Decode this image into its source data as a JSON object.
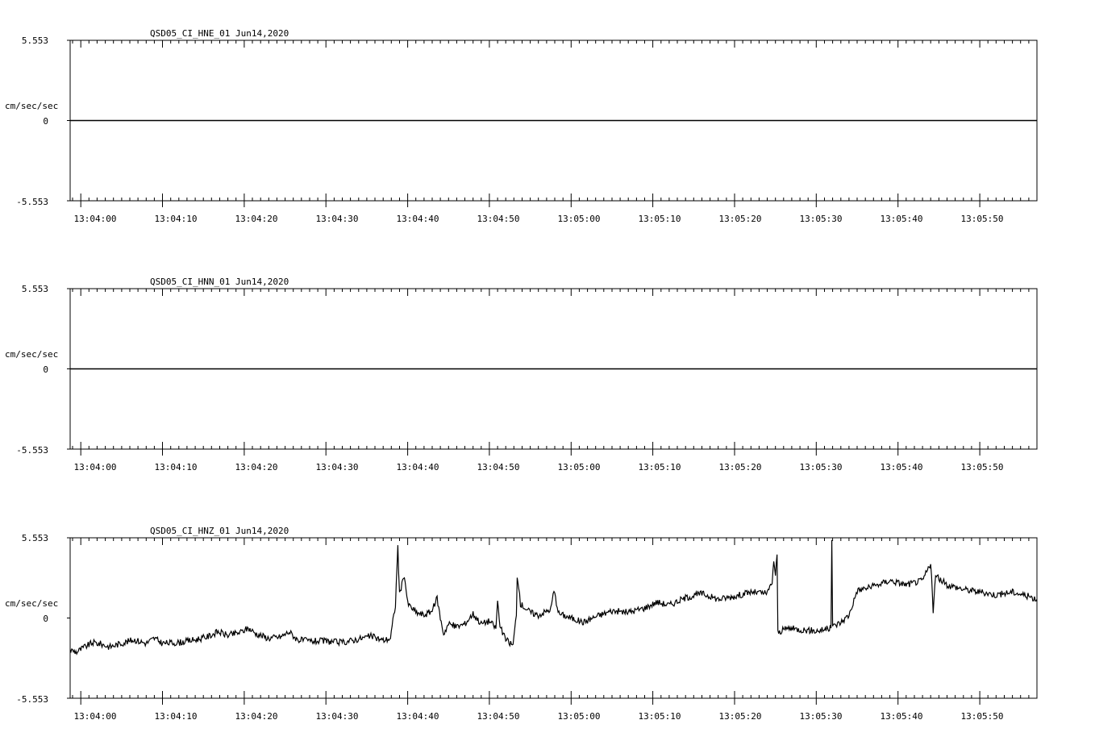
{
  "chart_data": [
    {
      "type": "line",
      "title": "QSD05_CI_HNE_01  Jun14,2020",
      "ylabel": "cm/sec/sec",
      "ylim": [
        -5.553,
        5.553
      ],
      "ytick_labels": [
        "5.553",
        "0",
        "-5.553"
      ],
      "x_range_seconds": [
        "13:03:58.7",
        "13:05:57.0"
      ],
      "xtick_labels": [
        "13:04:00",
        "13:04:10",
        "13:04:20",
        "13:04:30",
        "13:04:40",
        "13:04:50",
        "13:05:00",
        "13:05:10",
        "13:05:20",
        "13:05:30",
        "13:05:40",
        "13:05:50"
      ],
      "series": [
        {
          "values": [
            {
              "x": "13:03:58.7",
              "y": 0.0
            },
            {
              "x": "13:04:20.0",
              "y": 0.0
            },
            {
              "x": "13:04:40.0",
              "y": 0.0
            },
            {
              "x": "13:05:00.0",
              "y": 0.0
            },
            {
              "x": "13:05:20.0",
              "y": 0.0
            },
            {
              "x": "13:05:40.0",
              "y": 0.0
            },
            {
              "x": "13:05:57.0",
              "y": 0.0
            }
          ]
        }
      ]
    },
    {
      "type": "line",
      "title": "QSD05_CI_HNN_01  Jun14,2020",
      "ylabel": "cm/sec/sec",
      "ylim": [
        -5.553,
        5.553
      ],
      "ytick_labels": [
        "5.553",
        "0",
        "-5.553"
      ],
      "x_range_seconds": [
        "13:03:58.7",
        "13:05:57.0"
      ],
      "xtick_labels": [
        "13:04:00",
        "13:04:10",
        "13:04:20",
        "13:04:30",
        "13:04:40",
        "13:04:50",
        "13:05:00",
        "13:05:10",
        "13:05:20",
        "13:05:30",
        "13:05:40",
        "13:05:50"
      ],
      "series": [
        {
          "values": [
            {
              "x": "13:03:58.7",
              "y": 0.0
            },
            {
              "x": "13:04:20.0",
              "y": 0.0
            },
            {
              "x": "13:04:40.0",
              "y": 0.0
            },
            {
              "x": "13:05:00.0",
              "y": 0.0
            },
            {
              "x": "13:05:20.0",
              "y": 0.0
            },
            {
              "x": "13:05:40.0",
              "y": 0.0
            },
            {
              "x": "13:05:57.0",
              "y": 0.0
            }
          ]
        }
      ]
    },
    {
      "type": "line",
      "title": "QSD05_CI_HNZ_01  Jun14,2020",
      "ylabel": "cm/sec/sec",
      "ylim": [
        -5.553,
        5.553
      ],
      "ytick_labels": [
        "5.553",
        "0",
        "-5.553"
      ],
      "x_range_seconds": [
        "13:03:58.7",
        "13:05:57.0"
      ],
      "xtick_labels": [
        "13:04:00",
        "13:04:10",
        "13:04:20",
        "13:04:30",
        "13:04:40",
        "13:04:50",
        "13:05:00",
        "13:05:10",
        "13:05:20",
        "13:05:30",
        "13:05:40",
        "13:05:50"
      ],
      "series": [
        {
          "values": [
            {
              "x": "13:03:58.7",
              "y": -2.2
            },
            {
              "x": "13:03:59.5",
              "y": -2.35
            },
            {
              "x": "13:04:00.5",
              "y": -2.0
            },
            {
              "x": "13:04:01.5",
              "y": -1.7
            },
            {
              "x": "13:04:02.5",
              "y": -1.8
            },
            {
              "x": "13:04:03.5",
              "y": -2.0
            },
            {
              "x": "13:04:05.0",
              "y": -1.75
            },
            {
              "x": "13:04:06.5",
              "y": -1.5
            },
            {
              "x": "13:04:08.0",
              "y": -1.75
            },
            {
              "x": "13:04:09.0",
              "y": -1.4
            },
            {
              "x": "13:04:10.0",
              "y": -1.75
            },
            {
              "x": "13:04:12.0",
              "y": -1.7
            },
            {
              "x": "13:04:14.0",
              "y": -1.5
            },
            {
              "x": "13:04:15.5",
              "y": -1.3
            },
            {
              "x": "13:04:16.8",
              "y": -0.95
            },
            {
              "x": "13:04:18.0",
              "y": -1.2
            },
            {
              "x": "13:04:19.5",
              "y": -1.0
            },
            {
              "x": "13:04:20.5",
              "y": -0.7
            },
            {
              "x": "13:04:21.5",
              "y": -1.1
            },
            {
              "x": "13:04:23.0",
              "y": -1.4
            },
            {
              "x": "13:04:24.5",
              "y": -1.3
            },
            {
              "x": "13:04:25.5",
              "y": -0.95
            },
            {
              "x": "13:04:26.5",
              "y": -1.5
            },
            {
              "x": "13:04:28.0",
              "y": -1.6
            },
            {
              "x": "13:04:30.0",
              "y": -1.6
            },
            {
              "x": "13:04:32.0",
              "y": -1.7
            },
            {
              "x": "13:04:34.0",
              "y": -1.45
            },
            {
              "x": "13:04:35.5",
              "y": -1.25
            },
            {
              "x": "13:04:37.0",
              "y": -1.55
            },
            {
              "x": "13:04:37.9",
              "y": -1.4
            },
            {
              "x": "13:04:38.2",
              "y": -0.2
            },
            {
              "x": "13:04:38.5",
              "y": 0.9
            },
            {
              "x": "13:04:38.8",
              "y": 5.0
            },
            {
              "x": "13:04:39.0",
              "y": 1.6
            },
            {
              "x": "13:04:39.6",
              "y": 3.0
            },
            {
              "x": "13:04:40.0",
              "y": 1.0
            },
            {
              "x": "13:04:41.0",
              "y": 0.4
            },
            {
              "x": "13:04:42.0",
              "y": 0.2
            },
            {
              "x": "13:04:43.0",
              "y": 0.5
            },
            {
              "x": "13:04:43.6",
              "y": 1.4
            },
            {
              "x": "13:04:44.0",
              "y": 0.0
            },
            {
              "x": "13:04:44.4",
              "y": -1.1
            },
            {
              "x": "13:04:45.0",
              "y": -0.4
            },
            {
              "x": "13:04:46.0",
              "y": -0.6
            },
            {
              "x": "13:04:47.0",
              "y": -0.4
            },
            {
              "x": "13:04:48.0",
              "y": 0.3
            },
            {
              "x": "13:04:49.0",
              "y": -0.4
            },
            {
              "x": "13:04:50.0",
              "y": -0.2
            },
            {
              "x": "13:04:50.8",
              "y": -0.7
            },
            {
              "x": "13:04:51.0",
              "y": 1.2
            },
            {
              "x": "13:04:51.3",
              "y": -0.6
            },
            {
              "x": "13:04:52.0",
              "y": -1.5
            },
            {
              "x": "13:04:52.9",
              "y": -1.9
            },
            {
              "x": "13:04:53.3",
              "y": 0.3
            },
            {
              "x": "13:04:53.4",
              "y": 3.0
            },
            {
              "x": "13:04:53.8",
              "y": 1.0
            },
            {
              "x": "13:04:55.0",
              "y": 0.4
            },
            {
              "x": "13:04:56.0",
              "y": 0.2
            },
            {
              "x": "13:04:57.5",
              "y": 0.6
            },
            {
              "x": "13:04:57.9",
              "y": 1.9
            },
            {
              "x": "13:04:58.5",
              "y": 0.3
            },
            {
              "x": "13:05:00.0",
              "y": 0.0
            },
            {
              "x": "13:05:01.5",
              "y": -0.3
            },
            {
              "x": "13:05:03.0",
              "y": 0.1
            },
            {
              "x": "13:05:05.0",
              "y": 0.5
            },
            {
              "x": "13:05:07.0",
              "y": 0.4
            },
            {
              "x": "13:05:09.0",
              "y": 0.7
            },
            {
              "x": "13:05:10.5",
              "y": 1.1
            },
            {
              "x": "13:05:12.0",
              "y": 0.9
            },
            {
              "x": "13:05:14.0",
              "y": 1.4
            },
            {
              "x": "13:05:16.0",
              "y": 1.7
            },
            {
              "x": "13:05:18.0",
              "y": 1.3
            },
            {
              "x": "13:05:20.0",
              "y": 1.5
            },
            {
              "x": "13:05:22.0",
              "y": 1.8
            },
            {
              "x": "13:05:24.0",
              "y": 1.7
            },
            {
              "x": "13:05:24.6",
              "y": 2.5
            },
            {
              "x": "13:05:24.8",
              "y": 4.0
            },
            {
              "x": "13:05:25.0",
              "y": 2.8
            },
            {
              "x": "13:05:25.2",
              "y": 4.5
            },
            {
              "x": "13:05:25.3",
              "y": -1.0
            },
            {
              "x": "13:05:26.5",
              "y": -0.7
            },
            {
              "x": "13:05:28.0",
              "y": -0.8
            },
            {
              "x": "13:05:30.0",
              "y": -0.9
            },
            {
              "x": "13:05:31.8",
              "y": -0.7
            },
            {
              "x": "13:05:31.9",
              "y": 5.5
            },
            {
              "x": "13:05:32.0",
              "y": -0.6
            },
            {
              "x": "13:05:33.0",
              "y": -0.3
            },
            {
              "x": "13:05:34.0",
              "y": 0.2
            },
            {
              "x": "13:05:35.0",
              "y": 1.9
            },
            {
              "x": "13:05:37.0",
              "y": 2.2
            },
            {
              "x": "13:05:39.0",
              "y": 2.6
            },
            {
              "x": "13:05:41.0",
              "y": 2.3
            },
            {
              "x": "13:05:43.0",
              "y": 2.6
            },
            {
              "x": "13:05:44.0",
              "y": 3.8
            },
            {
              "x": "13:05:44.3",
              "y": 0.5
            },
            {
              "x": "13:05:44.6",
              "y": 2.9
            },
            {
              "x": "13:05:46.0",
              "y": 2.3
            },
            {
              "x": "13:05:48.0",
              "y": 2.0
            },
            {
              "x": "13:05:50.0",
              "y": 1.8
            },
            {
              "x": "13:05:52.0",
              "y": 1.6
            },
            {
              "x": "13:05:54.0",
              "y": 1.8
            },
            {
              "x": "13:05:56.0",
              "y": 1.5
            },
            {
              "x": "13:05:57.0",
              "y": 1.3
            }
          ]
        }
      ]
    }
  ]
}
